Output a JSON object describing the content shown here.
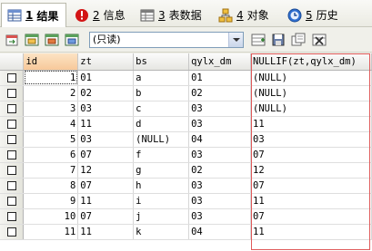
{
  "tabs": [
    {
      "num": "1",
      "label": "结果",
      "icon": "grid-icon",
      "active": true
    },
    {
      "num": "2",
      "label": "信息",
      "icon": "info-icon",
      "active": false
    },
    {
      "num": "3",
      "label": "表数据",
      "icon": "table-data-icon",
      "active": false
    },
    {
      "num": "4",
      "label": "对象",
      "icon": "objects-icon",
      "active": false
    },
    {
      "num": "5",
      "label": "历史",
      "icon": "history-icon",
      "active": false
    }
  ],
  "toolbar": {
    "mode_value": "(只读)",
    "left_icons": [
      "export-icon",
      "grid-copy-icon",
      "grid-edit-icon",
      "grid-filter-icon",
      "grid-refresh-icon"
    ],
    "right_icons": [
      "insert-row-icon",
      "save-icon",
      "duplicate-icon",
      "delete-row-icon"
    ]
  },
  "grid": {
    "columns": [
      "id",
      "zt",
      "bs",
      "qylx_dm",
      "NULLIF(zt,qylx_dm)"
    ],
    "rows": [
      [
        "1",
        "01",
        "a",
        "01",
        "(NULL)"
      ],
      [
        "2",
        "02",
        "b",
        "02",
        "(NULL)"
      ],
      [
        "3",
        "03",
        "c",
        "03",
        "(NULL)"
      ],
      [
        "4",
        "11",
        "d",
        "03",
        "11"
      ],
      [
        "5",
        "03",
        "(NULL)",
        "04",
        "03"
      ],
      [
        "6",
        "07",
        "f",
        "03",
        "07"
      ],
      [
        "7",
        "12",
        "g",
        "02",
        "12"
      ],
      [
        "8",
        "07",
        "h",
        "03",
        "07"
      ],
      [
        "9",
        "11",
        "i",
        "03",
        "11"
      ],
      [
        "10",
        "07",
        "j",
        "03",
        "07"
      ],
      [
        "11",
        "11",
        "k",
        "04",
        "11"
      ]
    ]
  },
  "colors": {
    "highlight_border": "#e05a5a",
    "active_header": "#f7c99a"
  }
}
